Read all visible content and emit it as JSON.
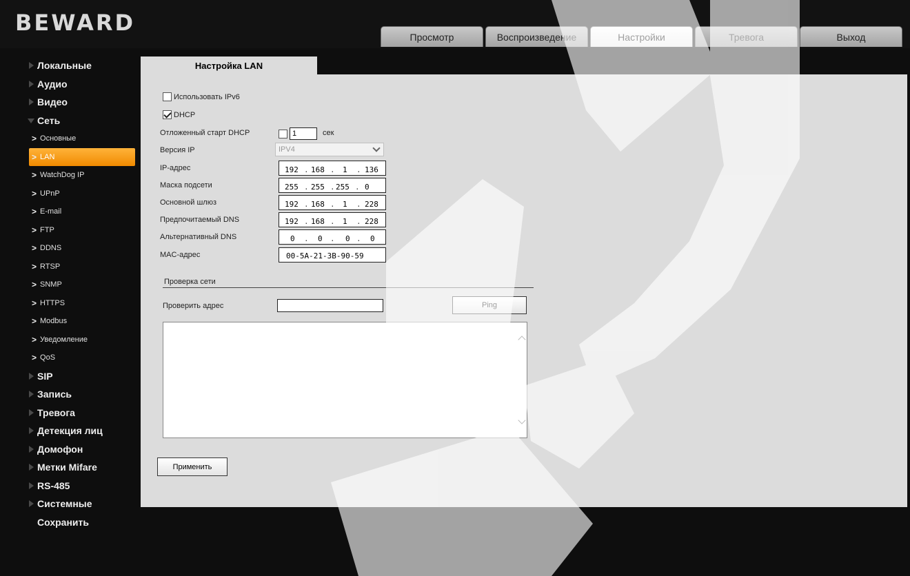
{
  "header": {
    "logo": "BEWARD",
    "tabs": [
      {
        "label": "Просмотр"
      },
      {
        "label": "Воспроизведение"
      },
      {
        "label": "Настройки"
      },
      {
        "label": "Тревога"
      },
      {
        "label": "Выход"
      }
    ],
    "active_tab": "Настройки"
  },
  "sidebar": {
    "items_before": [
      {
        "label": "Локальные"
      },
      {
        "label": "Аудио"
      },
      {
        "label": "Видео"
      }
    ],
    "open_item": {
      "label": "Сеть"
    },
    "sub_items": [
      {
        "label": "Основные"
      },
      {
        "label": "LAN"
      },
      {
        "label": "WatchDog IP"
      },
      {
        "label": "UPnP"
      },
      {
        "label": "E-mail"
      },
      {
        "label": "FTP"
      },
      {
        "label": "DDNS"
      },
      {
        "label": "RTSP"
      },
      {
        "label": "SNMP"
      },
      {
        "label": "HTTPS"
      },
      {
        "label": "Modbus"
      },
      {
        "label": "Уведомление"
      },
      {
        "label": "QoS"
      }
    ],
    "active_sub": "LAN",
    "items_after": [
      {
        "label": "SIP"
      },
      {
        "label": "Запись"
      },
      {
        "label": "Тревога"
      },
      {
        "label": "Детекция лиц"
      },
      {
        "label": "Домофон"
      },
      {
        "label": "Метки Mifare"
      },
      {
        "label": "RS-485"
      },
      {
        "label": "Системные"
      }
    ],
    "save": "Сохранить"
  },
  "content": {
    "tab_title": "Настройка LAN",
    "use_ipv6": {
      "label": "Использовать IPv6",
      "checked": false
    },
    "dhcp": {
      "label": "DHCP",
      "checked": true
    },
    "dhcp_delay": {
      "label": "Отложенный старт DHCP",
      "checked": false,
      "value": "1",
      "unit": "сек"
    },
    "ip_version": {
      "label": "Версия IP",
      "value": "IPV4"
    },
    "ip_address": {
      "label": "IP-адрес",
      "octets": [
        "192",
        "168",
        "1",
        "136"
      ]
    },
    "subnet_mask": {
      "label": "Маска подсети",
      "octets": [
        "255",
        "255",
        "255",
        "0"
      ]
    },
    "gateway": {
      "label": "Основной шлюз",
      "octets": [
        "192",
        "168",
        "1",
        "228"
      ]
    },
    "preferred_dns": {
      "label": "Предпочитаемый DNS",
      "octets": [
        "192",
        "168",
        "1",
        "228"
      ]
    },
    "alternate_dns": {
      "label": "Альтернативный DNS",
      "octets": [
        "0",
        "0",
        "0",
        "0"
      ]
    },
    "mac": {
      "label": "MAC-адрес",
      "value": "00-5A-21-3B-90-59"
    },
    "network_check": {
      "section_title": "Проверка сети",
      "address_label": "Проверить адрес",
      "address_value": "",
      "ping_label": "Ping",
      "output": ""
    },
    "apply_label": "Применить"
  },
  "colors": {
    "background": "#0e0e0e",
    "panel": "#dcdcdc",
    "active_sub_start": "#ffb33a",
    "active_sub_end": "#f08a00",
    "watermark": "#ffffff"
  }
}
